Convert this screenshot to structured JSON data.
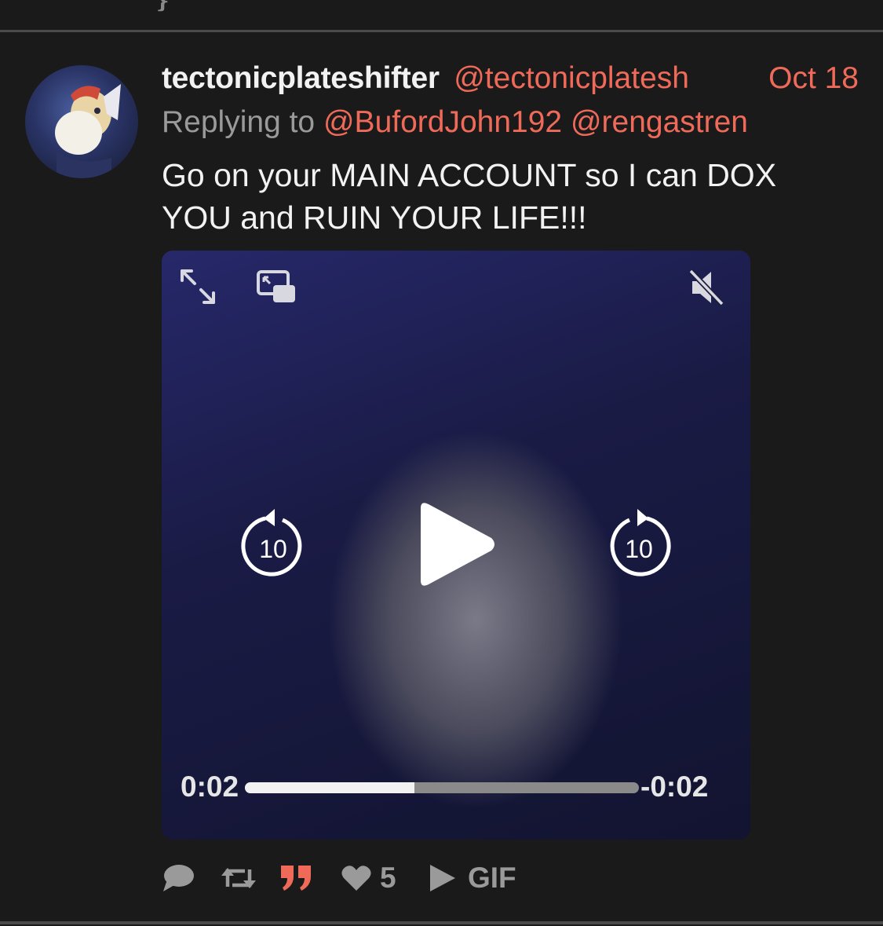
{
  "colors": {
    "background": "#1a1a1a",
    "accent": "#f06a5a",
    "text": "#f2f2f2",
    "muted": "#9a9a9a",
    "quote_icon": "#f06a5a"
  },
  "post": {
    "display_name": "tectonicplateshifter",
    "handle": "@tectonicplatesh",
    "date": "Oct 18",
    "reply_prefix": "Replying to",
    "reply_mentions": [
      "@BufordJohn192",
      "@rengastren"
    ],
    "text_line1": "Go on your MAIN ACCOUNT so I can DOX",
    "text_line2": "YOU and RUIN YOUR LIFE!!!"
  },
  "video": {
    "current_time": "0:02",
    "remaining_time": "-0:02",
    "progress": 0.43,
    "skip_back_label": "10",
    "skip_forward_label": "10",
    "icons": [
      "expand-icon",
      "picture-in-picture-icon",
      "mute-icon",
      "skip-back-icon",
      "play-icon",
      "skip-forward-icon"
    ]
  },
  "actions": {
    "like_count": "5",
    "gif_label": "GIF",
    "icons": [
      "reply-icon",
      "retweet-icon",
      "quote-icon",
      "heart-icon",
      "gif-play-icon"
    ]
  }
}
